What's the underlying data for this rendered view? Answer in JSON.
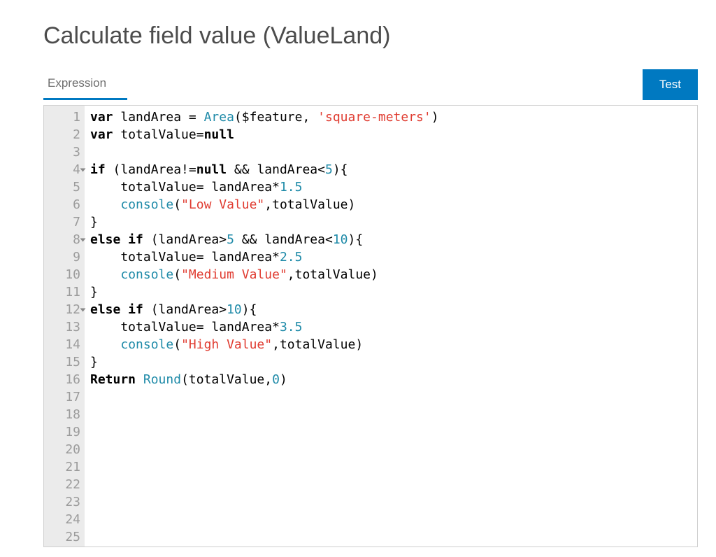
{
  "header": {
    "title": "Calculate field value (ValueLand)"
  },
  "tabs": {
    "expression": "Expression"
  },
  "buttons": {
    "test": "Test"
  },
  "editor": {
    "total_lines": 25,
    "fold_lines": [
      4,
      8,
      12
    ],
    "code_lines": [
      {
        "n": 1,
        "tokens": [
          {
            "t": "kw",
            "v": "var"
          },
          {
            "t": "sym",
            "v": " "
          },
          {
            "t": "id",
            "v": "landArea = "
          },
          {
            "t": "fn",
            "v": "Area"
          },
          {
            "t": "sym",
            "v": "($feature, "
          },
          {
            "t": "str",
            "v": "'square-meters'"
          },
          {
            "t": "sym",
            "v": ")"
          }
        ]
      },
      {
        "n": 2,
        "tokens": [
          {
            "t": "kw",
            "v": "var"
          },
          {
            "t": "sym",
            "v": " "
          },
          {
            "t": "id",
            "v": "totalValue="
          },
          {
            "t": "kw",
            "v": "null"
          }
        ]
      },
      {
        "n": 3,
        "tokens": []
      },
      {
        "n": 4,
        "tokens": [
          {
            "t": "kw",
            "v": "if"
          },
          {
            "t": "sym",
            "v": " (landArea!="
          },
          {
            "t": "kw",
            "v": "null"
          },
          {
            "t": "sym",
            "v": " && landArea<"
          },
          {
            "t": "num",
            "v": "5"
          },
          {
            "t": "sym",
            "v": "){"
          }
        ]
      },
      {
        "n": 5,
        "tokens": [
          {
            "t": "sym",
            "v": "    totalValue= landArea*"
          },
          {
            "t": "num",
            "v": "1.5"
          }
        ]
      },
      {
        "n": 6,
        "tokens": [
          {
            "t": "sym",
            "v": "    "
          },
          {
            "t": "fn",
            "v": "console"
          },
          {
            "t": "sym",
            "v": "("
          },
          {
            "t": "str",
            "v": "\"Low Value\""
          },
          {
            "t": "sym",
            "v": ",totalValue)"
          }
        ]
      },
      {
        "n": 7,
        "tokens": [
          {
            "t": "sym",
            "v": "}"
          }
        ]
      },
      {
        "n": 8,
        "tokens": [
          {
            "t": "kw",
            "v": "else if"
          },
          {
            "t": "sym",
            "v": " (landArea>"
          },
          {
            "t": "num",
            "v": "5"
          },
          {
            "t": "sym",
            "v": " && landArea<"
          },
          {
            "t": "num",
            "v": "10"
          },
          {
            "t": "sym",
            "v": "){"
          }
        ]
      },
      {
        "n": 9,
        "tokens": [
          {
            "t": "sym",
            "v": "    totalValue= landArea*"
          },
          {
            "t": "num",
            "v": "2.5"
          }
        ]
      },
      {
        "n": 10,
        "tokens": [
          {
            "t": "sym",
            "v": "    "
          },
          {
            "t": "fn",
            "v": "console"
          },
          {
            "t": "sym",
            "v": "("
          },
          {
            "t": "str",
            "v": "\"Medium Value\""
          },
          {
            "t": "sym",
            "v": ",totalValue)"
          }
        ]
      },
      {
        "n": 11,
        "tokens": [
          {
            "t": "sym",
            "v": "}"
          }
        ]
      },
      {
        "n": 12,
        "tokens": [
          {
            "t": "kw",
            "v": "else if"
          },
          {
            "t": "sym",
            "v": " (landArea>"
          },
          {
            "t": "num",
            "v": "10"
          },
          {
            "t": "sym",
            "v": "){"
          }
        ]
      },
      {
        "n": 13,
        "tokens": [
          {
            "t": "sym",
            "v": "    totalValue= landArea*"
          },
          {
            "t": "num",
            "v": "3.5"
          }
        ]
      },
      {
        "n": 14,
        "tokens": [
          {
            "t": "sym",
            "v": "    "
          },
          {
            "t": "fn",
            "v": "console"
          },
          {
            "t": "sym",
            "v": "("
          },
          {
            "t": "str",
            "v": "\"High Value\""
          },
          {
            "t": "sym",
            "v": ",totalValue)"
          }
        ]
      },
      {
        "n": 15,
        "tokens": [
          {
            "t": "sym",
            "v": "}"
          }
        ]
      },
      {
        "n": 16,
        "tokens": [
          {
            "t": "kw",
            "v": "Return"
          },
          {
            "t": "sym",
            "v": " "
          },
          {
            "t": "fn",
            "v": "Round"
          },
          {
            "t": "sym",
            "v": "(totalValue,"
          },
          {
            "t": "num",
            "v": "0"
          },
          {
            "t": "sym",
            "v": ")"
          }
        ]
      }
    ]
  }
}
